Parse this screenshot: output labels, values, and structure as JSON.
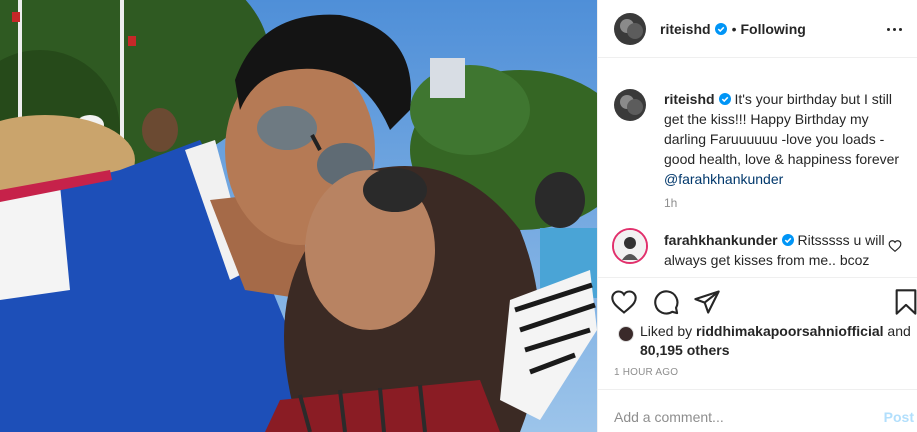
{
  "post": {
    "username": "riteishd",
    "separator": "•",
    "follow_status": "Following"
  },
  "caption": {
    "username": "riteishd",
    "text": "It's your birthday but I still get the kiss!!! Happy Birthday my darling Faruuuuuu -love you loads - good health, love & happiness forever ",
    "mention": "@farahkhankunder",
    "time": "1h"
  },
  "reply": {
    "username": "farahkhankunder",
    "text": "Ritsssss u will always get kisses from me.. bcoz"
  },
  "likes": {
    "prefix": "Liked by ",
    "user": "riddhimakapoorsahniofficial",
    "and": " and",
    "count": "80,195 others"
  },
  "timestamp": "1 HOUR AGO",
  "add_comment": {
    "placeholder": "Add a comment...",
    "post_label": "Post"
  },
  "icons": [
    "heart-icon",
    "comment-icon",
    "share-icon",
    "bookmark-icon",
    "more-options-icon",
    "verified-badge-icon"
  ],
  "colors": {
    "verified": "#0095f6",
    "mention": "#00376b",
    "secondary_text": "#8e8e8e",
    "post_disabled": "#b2dffc",
    "jacket_blue": "#1d4fb8"
  }
}
